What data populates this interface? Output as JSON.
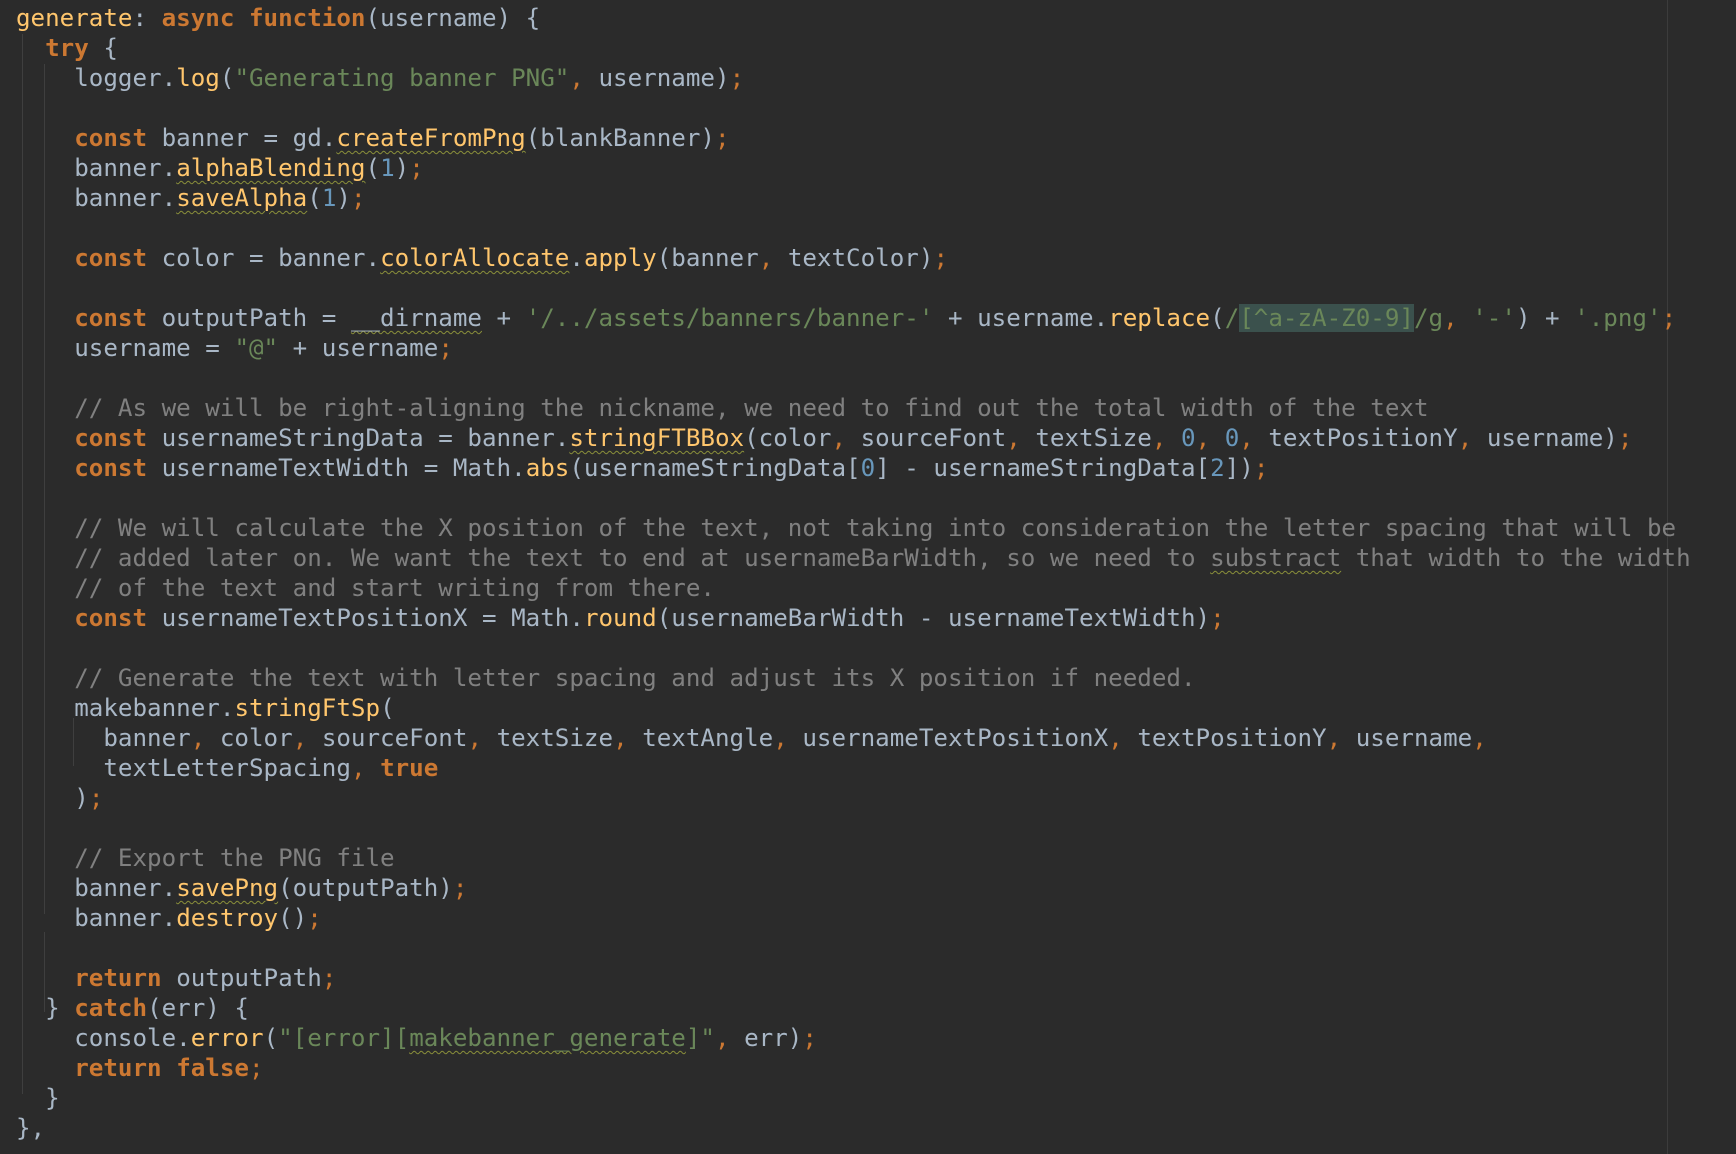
{
  "editor": {
    "colors": {
      "background": "#2b2b2b",
      "default": "#a9b7c6",
      "keyword": "#cc7832",
      "function": "#ffc66d",
      "string": "#6a8759",
      "number": "#6897bb",
      "comment": "#808080",
      "regex_highlight": "#3b514d",
      "typo_underline": "#8a8f3a"
    },
    "lines": [
      [
        {
          "t": "generate",
          "c": "fn"
        },
        {
          "t": ": "
        },
        {
          "t": "async ",
          "c": "kw"
        },
        {
          "t": "function",
          "c": "kw"
        },
        {
          "t": "(username) {"
        }
      ],
      [
        {
          "t": "  "
        },
        {
          "t": "try",
          "c": "kw"
        },
        {
          "t": " {"
        }
      ],
      [
        {
          "t": "    logger."
        },
        {
          "t": "log",
          "c": "fn"
        },
        {
          "t": "("
        },
        {
          "t": "\"Generating banner PNG\"",
          "c": "str"
        },
        {
          "t": ", ",
          "c": "pun"
        },
        {
          "t": "username)"
        },
        {
          "t": ";",
          "c": "pun"
        }
      ],
      [],
      [
        {
          "t": "    "
        },
        {
          "t": "const ",
          "c": "kw"
        },
        {
          "t": "banner = gd."
        },
        {
          "t": "createFromPng",
          "c": "fn sq"
        },
        {
          "t": "(blankBanner)"
        },
        {
          "t": ";",
          "c": "pun"
        }
      ],
      [
        {
          "t": "    banner."
        },
        {
          "t": "alphaBlending",
          "c": "fn sq"
        },
        {
          "t": "("
        },
        {
          "t": "1",
          "c": "num"
        },
        {
          "t": ")"
        },
        {
          "t": ";",
          "c": "pun"
        }
      ],
      [
        {
          "t": "    banner."
        },
        {
          "t": "saveAlpha",
          "c": "fn sq"
        },
        {
          "t": "("
        },
        {
          "t": "1",
          "c": "num"
        },
        {
          "t": ")"
        },
        {
          "t": ";",
          "c": "pun"
        }
      ],
      [],
      [
        {
          "t": "    "
        },
        {
          "t": "const ",
          "c": "kw"
        },
        {
          "t": "color = banner."
        },
        {
          "t": "colorAllocate",
          "c": "fn sq"
        },
        {
          "t": "."
        },
        {
          "t": "apply",
          "c": "fn"
        },
        {
          "t": "(banner"
        },
        {
          "t": ", ",
          "c": "pun"
        },
        {
          "t": "textColor)"
        },
        {
          "t": ";",
          "c": "pun"
        }
      ],
      [],
      [
        {
          "t": "    "
        },
        {
          "t": "const ",
          "c": "kw"
        },
        {
          "t": "outputPath = "
        },
        {
          "t": "__dirname",
          "c": "sq"
        },
        {
          "t": " + "
        },
        {
          "t": "'/../assets/banners/banner-'",
          "c": "str"
        },
        {
          "t": " + username."
        },
        {
          "t": "replace",
          "c": "fn"
        },
        {
          "t": "("
        },
        {
          "t": "/",
          "c": "rx"
        },
        {
          "t": "[^a-zA-Z0-9]",
          "c": "rxhl"
        },
        {
          "t": "/g",
          "c": "rx"
        },
        {
          "t": ", ",
          "c": "pun"
        },
        {
          "t": "'-'",
          "c": "str"
        },
        {
          "t": ") + "
        },
        {
          "t": "'.png'",
          "c": "str"
        },
        {
          "t": ";",
          "c": "pun"
        }
      ],
      [
        {
          "t": "    username = "
        },
        {
          "t": "\"@\"",
          "c": "str"
        },
        {
          "t": " + username"
        },
        {
          "t": ";",
          "c": "pun"
        }
      ],
      [],
      [
        {
          "t": "    "
        },
        {
          "t": "// As we will be right-aligning the nickname, we need to find out the total width of the text",
          "c": "cm"
        }
      ],
      [
        {
          "t": "    "
        },
        {
          "t": "const ",
          "c": "kw"
        },
        {
          "t": "usernameStringData = banner."
        },
        {
          "t": "stringFTBBox",
          "c": "fn sq"
        },
        {
          "t": "(color"
        },
        {
          "t": ", ",
          "c": "pun"
        },
        {
          "t": "sourceFont"
        },
        {
          "t": ", ",
          "c": "pun"
        },
        {
          "t": "textSize"
        },
        {
          "t": ", ",
          "c": "pun"
        },
        {
          "t": "0",
          "c": "num"
        },
        {
          "t": ", ",
          "c": "pun"
        },
        {
          "t": "0",
          "c": "num"
        },
        {
          "t": ", ",
          "c": "pun"
        },
        {
          "t": "textPositionY"
        },
        {
          "t": ", ",
          "c": "pun"
        },
        {
          "t": "username)"
        },
        {
          "t": ";",
          "c": "pun"
        }
      ],
      [
        {
          "t": "    "
        },
        {
          "t": "const ",
          "c": "kw"
        },
        {
          "t": "usernameTextWidth = Math."
        },
        {
          "t": "abs",
          "c": "fn"
        },
        {
          "t": "(usernameStringData["
        },
        {
          "t": "0",
          "c": "num"
        },
        {
          "t": "] - usernameStringData["
        },
        {
          "t": "2",
          "c": "num"
        },
        {
          "t": "])"
        },
        {
          "t": ";",
          "c": "pun"
        }
      ],
      [],
      [
        {
          "t": "    "
        },
        {
          "t": "// We will calculate the X position of the text, not taking into consideration the letter spacing that will be",
          "c": "cm"
        }
      ],
      [
        {
          "t": "    "
        },
        {
          "t": "// added later on. We want the text to end at usernameBarWidth, so we need to ",
          "c": "cm"
        },
        {
          "t": "substract",
          "c": "cm sq"
        },
        {
          "t": " that width to the width",
          "c": "cm"
        }
      ],
      [
        {
          "t": "    "
        },
        {
          "t": "// of the text and start writing from there.",
          "c": "cm"
        }
      ],
      [
        {
          "t": "    "
        },
        {
          "t": "const ",
          "c": "kw"
        },
        {
          "t": "usernameTextPositionX = Math."
        },
        {
          "t": "round",
          "c": "fn"
        },
        {
          "t": "(usernameBarWidth - usernameTextWidth)"
        },
        {
          "t": ";",
          "c": "pun"
        }
      ],
      [],
      [
        {
          "t": "    "
        },
        {
          "t": "// Generate the text with letter spacing and adjust its X position if needed.",
          "c": "cm"
        }
      ],
      [
        {
          "t": "    makebanner."
        },
        {
          "t": "stringFtSp",
          "c": "fn"
        },
        {
          "t": "("
        }
      ],
      [
        {
          "t": "      banner"
        },
        {
          "t": ", ",
          "c": "pun"
        },
        {
          "t": "color"
        },
        {
          "t": ", ",
          "c": "pun"
        },
        {
          "t": "sourceFont"
        },
        {
          "t": ", ",
          "c": "pun"
        },
        {
          "t": "textSize"
        },
        {
          "t": ", ",
          "c": "pun"
        },
        {
          "t": "textAngle"
        },
        {
          "t": ", ",
          "c": "pun"
        },
        {
          "t": "usernameTextPositionX"
        },
        {
          "t": ", ",
          "c": "pun"
        },
        {
          "t": "textPositionY"
        },
        {
          "t": ", ",
          "c": "pun"
        },
        {
          "t": "username"
        },
        {
          "t": ",",
          "c": "pun"
        }
      ],
      [
        {
          "t": "      textLetterSpacing"
        },
        {
          "t": ", ",
          "c": "pun"
        },
        {
          "t": "true",
          "c": "kw"
        }
      ],
      [
        {
          "t": "    )"
        },
        {
          "t": ";",
          "c": "pun"
        }
      ],
      [],
      [
        {
          "t": "    "
        },
        {
          "t": "// Export the PNG file",
          "c": "cm"
        }
      ],
      [
        {
          "t": "    banner."
        },
        {
          "t": "savePng",
          "c": "fn sq"
        },
        {
          "t": "(outputPath)"
        },
        {
          "t": ";",
          "c": "pun"
        }
      ],
      [
        {
          "t": "    banner."
        },
        {
          "t": "destroy",
          "c": "fn"
        },
        {
          "t": "()"
        },
        {
          "t": ";",
          "c": "pun"
        }
      ],
      [],
      [
        {
          "t": "    "
        },
        {
          "t": "return ",
          "c": "kw"
        },
        {
          "t": "outputPath"
        },
        {
          "t": ";",
          "c": "pun"
        }
      ],
      [
        {
          "t": "  } "
        },
        {
          "t": "catch",
          "c": "kw"
        },
        {
          "t": "(err) {"
        }
      ],
      [
        {
          "t": "    console."
        },
        {
          "t": "error",
          "c": "fn"
        },
        {
          "t": "("
        },
        {
          "t": "\"[error][",
          "c": "str"
        },
        {
          "t": "makebanner_generate",
          "c": "str sq"
        },
        {
          "t": "]\"",
          "c": "str"
        },
        {
          "t": ", ",
          "c": "pun"
        },
        {
          "t": "err)"
        },
        {
          "t": ";",
          "c": "pun"
        }
      ],
      [
        {
          "t": "    "
        },
        {
          "t": "return ",
          "c": "kw"
        },
        {
          "t": "false",
          "c": "kw"
        },
        {
          "t": ";",
          "c": "pun"
        }
      ],
      [
        {
          "t": "  }"
        }
      ],
      [
        {
          "t": "},"
        }
      ]
    ]
  }
}
